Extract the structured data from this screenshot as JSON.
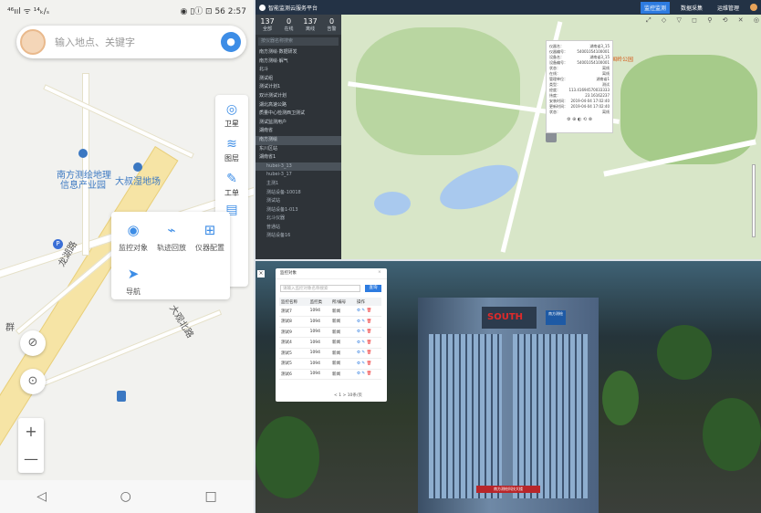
{
  "phone": {
    "status": {
      "signal": "⁴⁶ııl ᯤ ¹⁴ₖ/ₛ",
      "icons": "◉ ▯ⓘ ⊡",
      "battery": "56",
      "time": "2:57"
    },
    "search": {
      "placeholder": "输入地点、关键字",
      "voice_icon": "mic-icon"
    },
    "map_labels": {
      "poi1": "南方测绘地理",
      "poi1b": "信息产业园",
      "poi2": "大叔湿地场",
      "road1": "龙湖路",
      "road2": "大观北路",
      "edge": "群"
    },
    "side_controls": [
      {
        "label": "卫星",
        "icon": "satellite-icon"
      },
      {
        "label": "图层",
        "icon": "layers-icon"
      },
      {
        "label": "工单",
        "icon": "ticket-icon"
      },
      {
        "label": "",
        "icon": "ticket-icon"
      }
    ],
    "functions": [
      {
        "label": "监控对象",
        "icon": "monitor-icon"
      },
      {
        "label": "轨迹回放",
        "icon": "track-icon"
      },
      {
        "label": "仪器配置",
        "icon": "device-icon"
      },
      {
        "label": "导航",
        "icon": "navigation-icon"
      }
    ],
    "zoom": {
      "in": "+",
      "out": "—"
    },
    "nav": {
      "back": "◁",
      "home": "○",
      "recent": "□"
    }
  },
  "desktop": {
    "title": "智能监测云服务平台",
    "menu": [
      "监控监测",
      "数据采集",
      "运维管理"
    ],
    "stats": [
      {
        "value": "137",
        "label": "全部"
      },
      {
        "value": "0",
        "label": "在线"
      },
      {
        "value": "137",
        "label": "离线"
      },
      {
        "value": "0",
        "label": "告警"
      }
    ],
    "filter_placeholder": "按仪器名称搜索",
    "tree": [
      "南方测绘·数据研发",
      "南方测绘·解气",
      "北斗",
      "测试组",
      "测试计划1",
      "双计测试计划",
      "湖北高速公路",
      "质量中心检测西卫测试",
      "测试监测用户",
      "湖南省",
      "南方测绘",
      "东川区站",
      "湖南省1",
      "hubei-3_13",
      "hubei-3_17",
      "主测1",
      "测站设备-10018",
      "测试站",
      "测站设备1-013",
      "北斗仪器",
      "普通站",
      "测站设备16"
    ],
    "info": [
      [
        "仪器名：",
        "湖南省3_15"
      ],
      [
        "仪器编号：",
        "54001054100001"
      ],
      [
        "设备名：",
        "湖南省3_15"
      ],
      [
        "设备编号：",
        "54001054100001"
      ],
      [
        "状态：",
        "离线"
      ],
      [
        "在线：",
        "离线"
      ],
      [
        "管理单位：",
        "湖南省1"
      ],
      [
        "类型：",
        "测试"
      ],
      [
        "经度：",
        "113.41694570033333"
      ],
      [
        "纬度：",
        "23.16162237"
      ],
      [
        "安装时间：",
        "2019-04-04 17:02:40"
      ],
      [
        "更新时间：",
        "2019-04-04 17:02:40"
      ],
      [
        "状态：",
        "离线"
      ]
    ],
    "map_place": "南国岭公园"
  },
  "dialog": {
    "title": "监控对象",
    "search_placeholder": "请输入监控对象名称搜索",
    "query": "查询",
    "columns": [
      "监控名称",
      "监控类",
      "所/编号",
      "操作"
    ],
    "rows": [
      [
        "测试7",
        "1094",
        "新闻"
      ],
      [
        "测试8",
        "1094",
        "新闻"
      ],
      [
        "测试9",
        "1094",
        "新闻"
      ],
      [
        "测试4",
        "1094",
        "新闻"
      ],
      [
        "测试5",
        "1094",
        "新闻"
      ],
      [
        "测试5",
        "1094",
        "新闻"
      ],
      [
        "测试6",
        "1094",
        "新闻"
      ]
    ],
    "pagination": "< 1 > 10条/页"
  },
  "building": {
    "brand": "SOUTH",
    "brand_cn": "南方测绘",
    "sign": "南方测绘科技大楼"
  },
  "colors": {
    "accent": "#2d7be0",
    "topbar": "#233245",
    "panel": "#2e3338"
  }
}
